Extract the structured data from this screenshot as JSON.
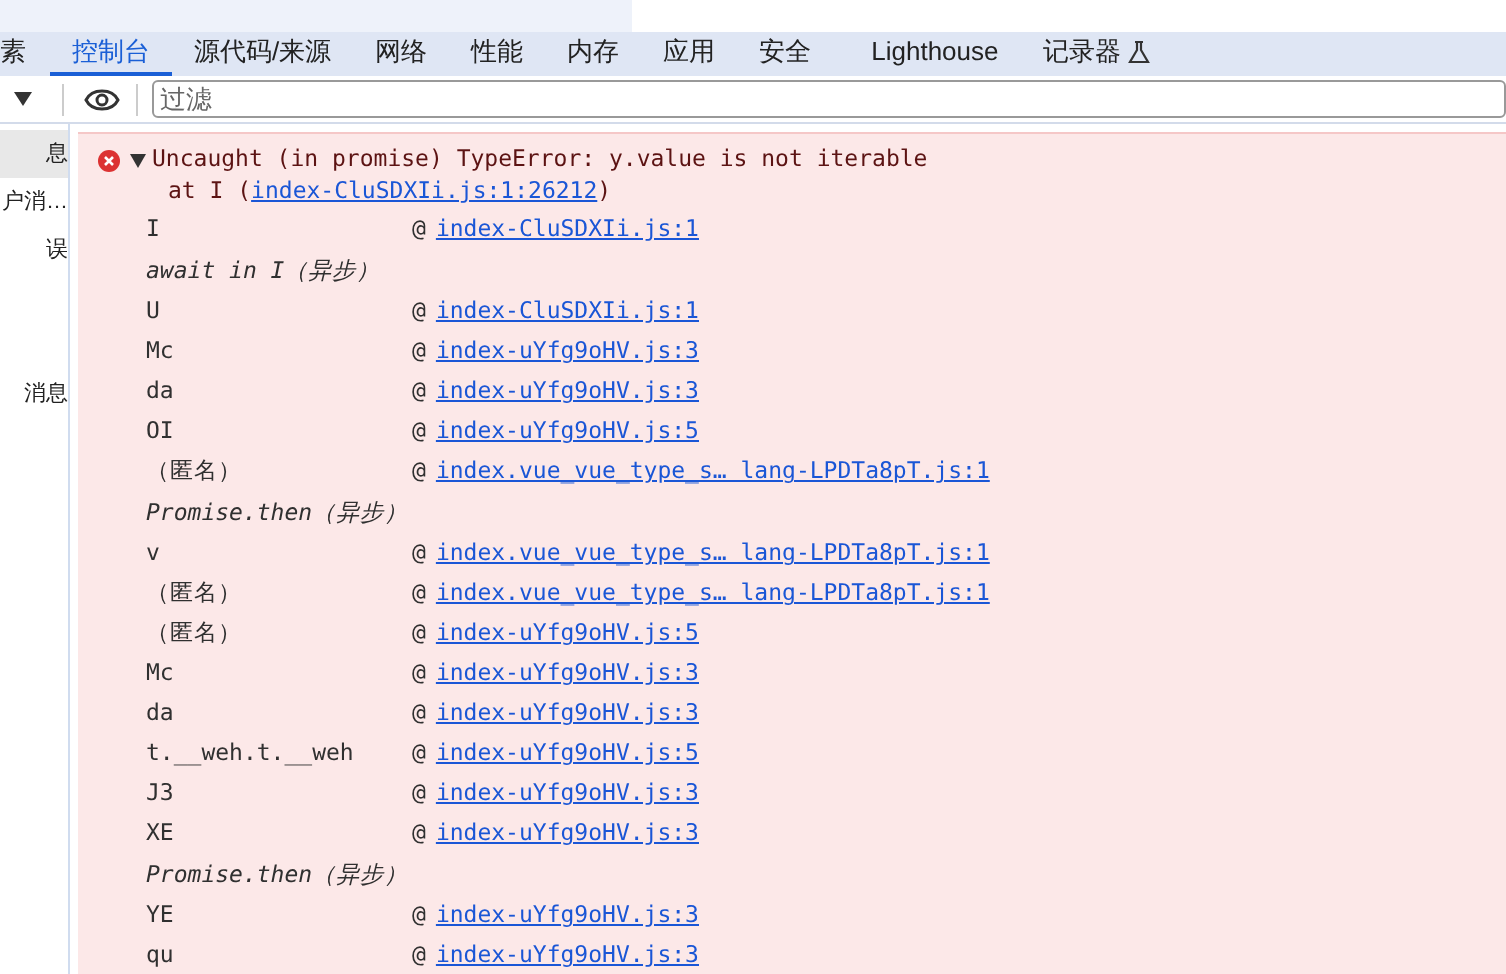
{
  "tabs": [
    {
      "label": "素",
      "selected": false
    },
    {
      "label": "控制台",
      "selected": true
    },
    {
      "label": "源代码/来源",
      "selected": false
    },
    {
      "label": "网络",
      "selected": false
    },
    {
      "label": "性能",
      "selected": false
    },
    {
      "label": "内存",
      "selected": false
    },
    {
      "label": "应用",
      "selected": false
    },
    {
      "label": "安全",
      "selected": false
    },
    {
      "label": "Lighthouse",
      "selected": false
    },
    {
      "label": "记录器",
      "selected": false,
      "experimental": true
    }
  ],
  "filter": {
    "placeholder": "过滤"
  },
  "sidebar": {
    "items": [
      {
        "label": "息",
        "selected": true
      },
      {
        "label": "户消…",
        "selected": false
      },
      {
        "label": "误",
        "selected": false
      },
      {
        "label": "消息",
        "selected": false
      }
    ]
  },
  "error": {
    "message": "Uncaught (in promise) TypeError: y.value is not iterable",
    "at_prefix": "at I (",
    "at_link": "index-CluSDXIi.js:1:26212",
    "at_suffix": ")",
    "frames": [
      {
        "kind": "frame",
        "name": "I",
        "at": "@",
        "source": "index-CluSDXIi.js:1"
      },
      {
        "kind": "async",
        "name": "await in I（异步）"
      },
      {
        "kind": "frame",
        "name": "U",
        "at": "@",
        "source": "index-CluSDXIi.js:1"
      },
      {
        "kind": "frame",
        "name": "Mc",
        "at": "@",
        "source": "index-uYfg9oHV.js:3"
      },
      {
        "kind": "frame",
        "name": "da",
        "at": "@",
        "source": "index-uYfg9oHV.js:3"
      },
      {
        "kind": "frame",
        "name": "OI",
        "at": "@",
        "source": "index-uYfg9oHV.js:5"
      },
      {
        "kind": "frame",
        "name": "（匿名）",
        "at": "@",
        "source": "index.vue_vue_type_s… lang-LPDTa8pT.js:1"
      },
      {
        "kind": "async",
        "name": "Promise.then（异步）"
      },
      {
        "kind": "frame",
        "name": "v",
        "at": "@",
        "source": "index.vue_vue_type_s… lang-LPDTa8pT.js:1"
      },
      {
        "kind": "frame",
        "name": "（匿名）",
        "at": "@",
        "source": "index.vue_vue_type_s… lang-LPDTa8pT.js:1"
      },
      {
        "kind": "frame",
        "name": "（匿名）",
        "at": "@",
        "source": "index-uYfg9oHV.js:5"
      },
      {
        "kind": "frame",
        "name": "Mc",
        "at": "@",
        "source": "index-uYfg9oHV.js:3"
      },
      {
        "kind": "frame",
        "name": "da",
        "at": "@",
        "source": "index-uYfg9oHV.js:3"
      },
      {
        "kind": "frame",
        "name": "t.__weh.t.__weh",
        "at": "@",
        "source": "index-uYfg9oHV.js:5"
      },
      {
        "kind": "frame",
        "name": "J3",
        "at": "@",
        "source": "index-uYfg9oHV.js:3"
      },
      {
        "kind": "frame",
        "name": "XE",
        "at": "@",
        "source": "index-uYfg9oHV.js:3"
      },
      {
        "kind": "async",
        "name": "Promise.then（异步）"
      },
      {
        "kind": "frame",
        "name": "YE",
        "at": "@",
        "source": "index-uYfg9oHV.js:3"
      },
      {
        "kind": "frame",
        "name": "qu",
        "at": "@",
        "source": "index-uYfg9oHV.js:3"
      }
    ]
  }
}
